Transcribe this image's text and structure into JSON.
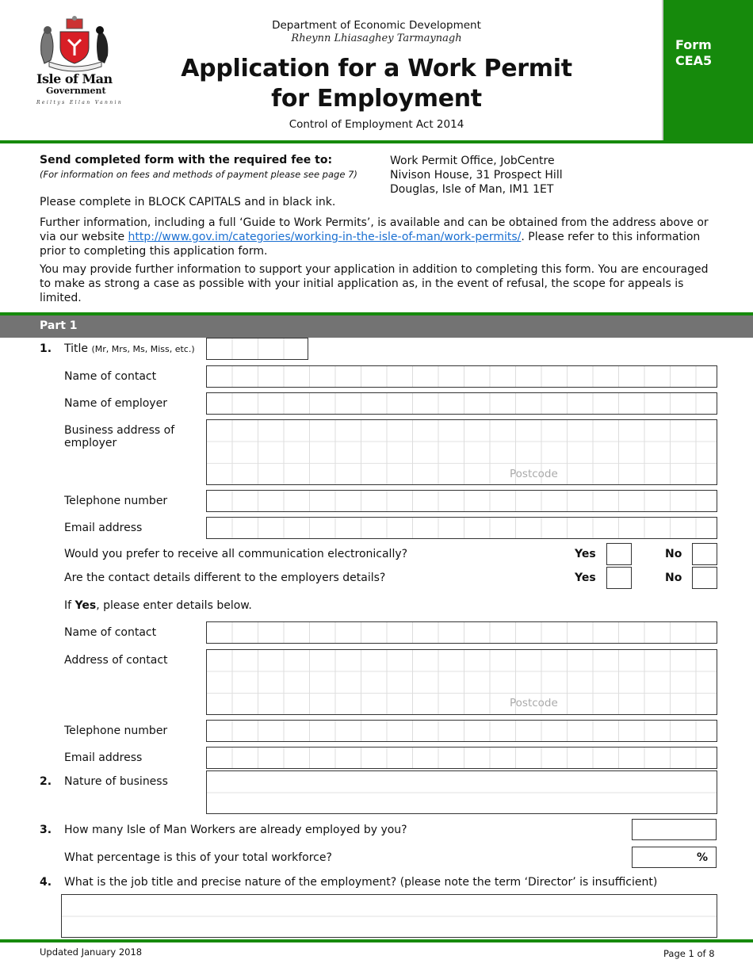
{
  "header": {
    "logo": {
      "name": "Isle of Man",
      "sub": "Government",
      "motto": "Reiltys Ellan Vannin"
    },
    "department": "Department of Economic Development",
    "department_manx": "Rheynn Lhiasaghey Tarmaynagh",
    "title_line1": "Application for a Work Permit",
    "title_line2": "for Employment",
    "act": "Control of Employment Act 2014",
    "form_label_line1": "Form",
    "form_label_line2": "CEA5",
    "brand_color": "#168a0c"
  },
  "intro": {
    "send_heading": "Send completed form with the required fee to:",
    "send_note": "(For information on fees and methods of payment please see page 7)",
    "address": [
      "Work Permit Office, JobCentre",
      "Nivison House, 31 Prospect Hill",
      "Douglas, Isle of Man, IM1 1ET"
    ],
    "block_capitals": "Please complete in BLOCK CAPITALS and in black ink.",
    "further_info_pre": "Further information, including a full ‘Guide to Work Permits’, is available and can be obtained from the address above or via our website ",
    "website_link": "http://www.gov.im/categories/working-in-the-isle-of-man/work-permits/",
    "further_info_post": ".  Please refer to this information prior to completing this application form.",
    "support_info": "You may provide further information to support your application in addition to completing this form.  You are encouraged to make as strong a case as possible with your initial application as, in the event of refusal, the scope for appeals is limited."
  },
  "part1": {
    "label": "Part 1",
    "q1": {
      "number": "1.",
      "title_label": "Title",
      "title_hint": "(Mr, Mrs, Ms, Miss, etc.)",
      "title_value": "",
      "name_of_contact_label": "Name of contact",
      "name_of_contact_value": "",
      "name_of_employer_label": "Name of employer",
      "name_of_employer_value": "",
      "business_address_label": "Business address of employer",
      "business_address_value": "",
      "postcode_placeholder": "Postcode",
      "telephone_label": "Telephone number",
      "telephone_value": "",
      "email_label": "Email address",
      "email_value": "",
      "electronic_question": "Would you prefer to receive all communication electronically?",
      "different_contact_question": "Are the contact details different to the employers details?",
      "yes_label": "Yes",
      "no_label": "No",
      "if_yes_pre": "If ",
      "if_yes_bold": "Yes",
      "if_yes_post": ", please enter details below.",
      "contact_name_label": "Name of contact",
      "contact_address_label": "Address of contact",
      "contact_telephone_label": "Telephone number",
      "contact_email_label": "Email address"
    },
    "q2": {
      "number": "2.",
      "label": "Nature of business",
      "value": ""
    },
    "q3": {
      "number": "3.",
      "label": "How many Isle of Man Workers are already employed by you?",
      "value": "",
      "pct_label": "What percentage is this of your total workforce?",
      "pct_value": "",
      "pct_symbol": "%"
    },
    "q4": {
      "number": "4.",
      "label": "What is the job title and precise nature of the employment? (please note the term ‘Director’ is insufficient)",
      "value": ""
    }
  },
  "footer": {
    "updated": "Updated January 2018",
    "page": "Page 1 of 8"
  }
}
